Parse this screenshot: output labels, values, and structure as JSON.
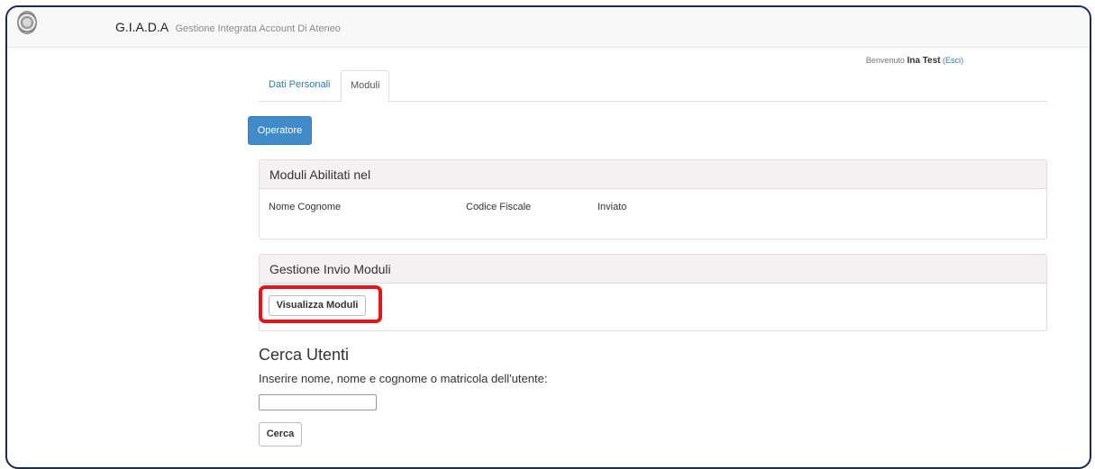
{
  "header": {
    "brand_name": "G.I.A.D.A",
    "brand_subtitle": "Gestione Integrata Account Di Ateneo",
    "logo_icon": "university-seal-icon"
  },
  "user": {
    "welcome_label": "Benvenuto",
    "name": "Ina Test",
    "logout_label": "Esci"
  },
  "tabs": [
    {
      "label": "Dati Personali",
      "active": false
    },
    {
      "label": "Moduli",
      "active": true
    }
  ],
  "operator_button": "Operatore",
  "panel_moduli": {
    "title": "Moduli Abilitati nel",
    "columns": [
      "Nome Cognome",
      "Codice Fiscale",
      "Inviato"
    ]
  },
  "panel_gestione": {
    "title": "Gestione Invio Moduli",
    "button": "Visualizza Moduli"
  },
  "search": {
    "title": "Cerca Utenti",
    "label": "Inserire nome, nome e cognome o matricola dell'utente:",
    "value": "",
    "button": "Cerca"
  },
  "colors": {
    "primary": "#428bca",
    "highlight": "#e8141b",
    "panel_heading": "#f5f0f1",
    "frame_border": "#1b2a4e"
  }
}
